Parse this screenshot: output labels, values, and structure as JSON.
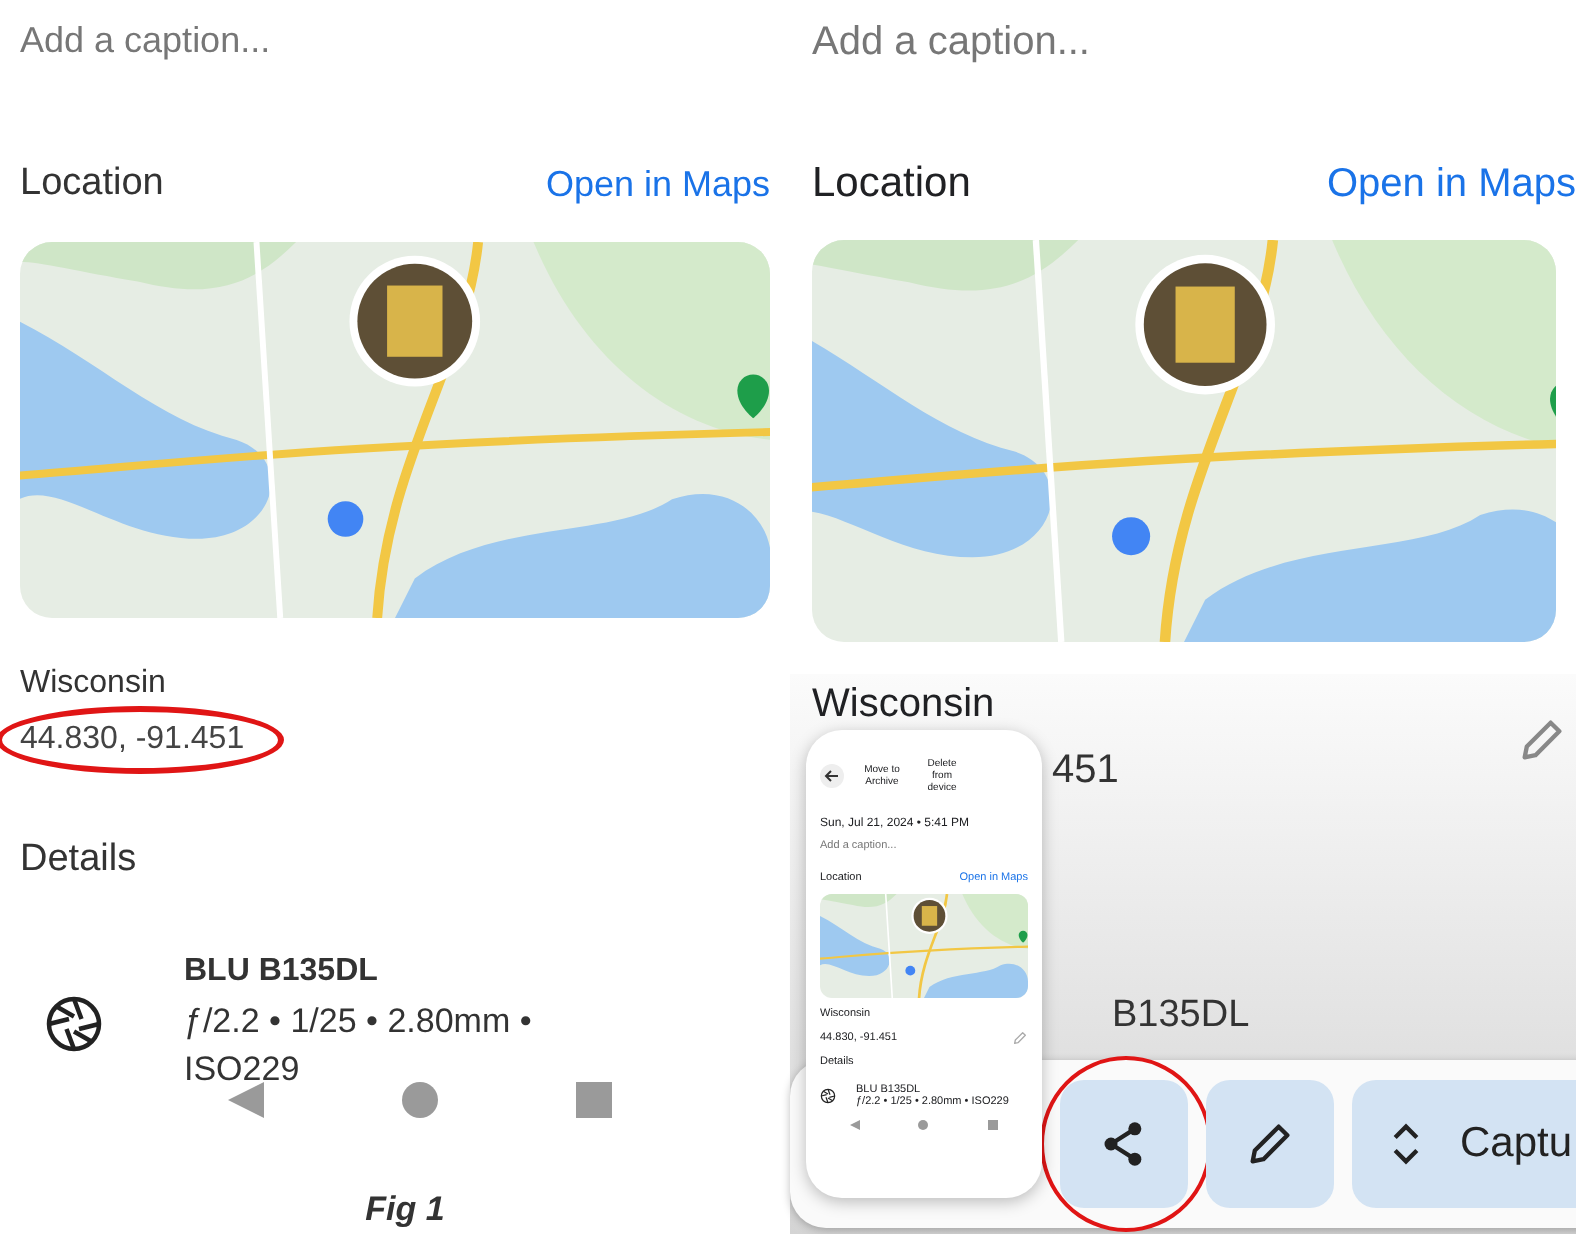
{
  "left_panel": {
    "caption_placeholder": "Add a caption...",
    "location_title": "Location",
    "maps_link": "Open in Maps",
    "map": {
      "kind": "picture"
    },
    "place": "Wisconsin",
    "coordinates": "44.830, -91.451",
    "coordinates_circled": true,
    "details_title": "Details",
    "device": {
      "model": "BLU B135DL",
      "specs": "ƒ/2.2 • 1/25 • 2.80mm • ISO229"
    },
    "figure_caption": "Fig 1"
  },
  "right_panel": {
    "caption_placeholder": "Add a caption...",
    "location_title": "Location",
    "maps_link": "Open in Maps",
    "map": {
      "kind": "picture"
    },
    "place": "Wisconsin",
    "coordinates_visible": "451",
    "model_visible": "B135DL",
    "thumbnail": {
      "actions": [
        "Move to Archive",
        "Delete from device"
      ],
      "date": "Sun, Jul 21, 2024 • 5:41 PM",
      "caption_placeholder": "Add a caption...",
      "location_title": "Location",
      "maps_link": "Open in Maps",
      "map": {
        "kind": "picture"
      },
      "place": "Wisconsin",
      "coordinates": "44.830, -91.451",
      "details_title": "Details",
      "model": "BLU B135DL",
      "specs": "ƒ/2.2 • 1/25 • 2.80mm • ISO229"
    },
    "toolbar": [
      {
        "kind": "share",
        "circled": true
      },
      {
        "kind": "edit",
        "circled": false
      },
      {
        "kind": "capture",
        "label": "Captu",
        "circled": false
      }
    ]
  }
}
